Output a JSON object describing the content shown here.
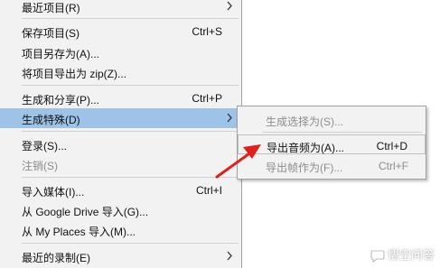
{
  "menu": {
    "items": [
      {
        "label": "最近项目(R)"
      },
      {
        "label": "保存项目(S)",
        "shortcut": "Ctrl+S"
      },
      {
        "label": "项目另存为(A)..."
      },
      {
        "label": "将项目导出为 zip(Z)..."
      },
      {
        "label": "生成和分享(P)...",
        "shortcut": "Ctrl+P"
      },
      {
        "label": "生成特殊(D)"
      },
      {
        "label": "登录(S)..."
      },
      {
        "label": "注销(S)"
      },
      {
        "label": "导入媒体(I)...",
        "shortcut": "Ctrl+I"
      },
      {
        "label": "从 Google Drive 导入(G)..."
      },
      {
        "label": "从 My Places 导入(M)..."
      },
      {
        "label": "最近的录制(E)"
      }
    ]
  },
  "submenu": {
    "items": [
      {
        "label": "生成选择为(S)..."
      },
      {
        "label": "导出音频为(A)...",
        "shortcut": "Ctrl+D"
      },
      {
        "label": "导出帧作为(F)...",
        "shortcut": "Ctrl+F"
      }
    ]
  },
  "watermark": {
    "text": "悟空问答"
  },
  "colors": {
    "menu_bg": "#f2f2f2",
    "highlight": "#9dc3e6",
    "disabled_text": "#8c8c8c",
    "annotation_arrow": "#e0201b"
  }
}
